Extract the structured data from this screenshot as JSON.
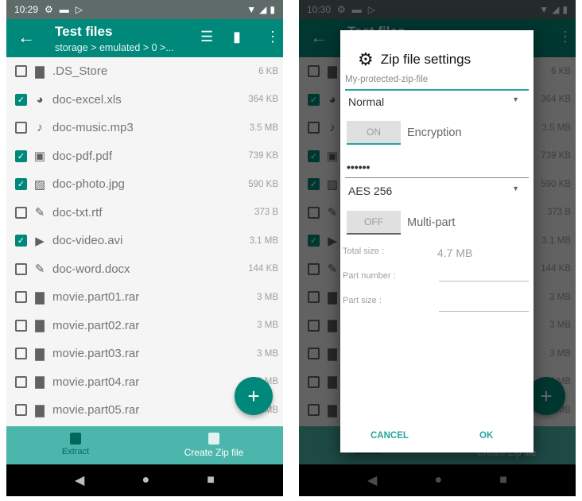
{
  "colors": {
    "primary": "#00897b",
    "bottom_nav": "#4db6ac",
    "status_bar": "#5e6b69"
  },
  "screens": [
    {
      "time": "10:29"
    },
    {
      "time": "10:30"
    }
  ],
  "toolbar": {
    "title": "Test files",
    "subtitle": "storage > emulated > 0 >..."
  },
  "files": [
    {
      "name": ".DS_Store",
      "size": "6 KB",
      "checked": false,
      "icon": "file-icon"
    },
    {
      "name": "doc-excel.xls",
      "size": "364 KB",
      "checked": true,
      "icon": "pie-chart-icon"
    },
    {
      "name": "doc-music.mp3",
      "size": "3.5 MB",
      "checked": false,
      "icon": "music-note-icon"
    },
    {
      "name": "doc-pdf.pdf",
      "size": "739 KB",
      "checked": true,
      "icon": "pdf-icon"
    },
    {
      "name": "doc-photo.jpg",
      "size": "590 KB",
      "checked": true,
      "icon": "image-icon"
    },
    {
      "name": "doc-txt.rtf",
      "size": "373 B",
      "checked": false,
      "icon": "pencil-icon"
    },
    {
      "name": "doc-video.avi",
      "size": "3.1 MB",
      "checked": true,
      "icon": "play-icon"
    },
    {
      "name": "doc-word.docx",
      "size": "144 KB",
      "checked": false,
      "icon": "pencil-icon"
    },
    {
      "name": "movie.part01.rar",
      "size": "3 MB",
      "checked": false,
      "icon": "file-icon"
    },
    {
      "name": "movie.part02.rar",
      "size": "3 MB",
      "checked": false,
      "icon": "file-icon"
    },
    {
      "name": "movie.part03.rar",
      "size": "3 MB",
      "checked": false,
      "icon": "file-icon"
    },
    {
      "name": "movie.part04.rar",
      "size": "3 MB",
      "checked": false,
      "icon": "file-icon"
    },
    {
      "name": "movie.part05.rar",
      "size": "3 MB",
      "checked": false,
      "icon": "file-icon"
    }
  ],
  "bottom_nav": {
    "extract": "Extract",
    "create": "Create Zip file",
    "active": "create"
  },
  "dialog": {
    "title": "Zip file settings",
    "filename": "My-protected-zip-file",
    "compression": "Normal",
    "encryption_toggle": "ON",
    "encryption_label": "Encryption",
    "password": "••••••",
    "algorithm": "AES 256",
    "multipart_toggle": "OFF",
    "multipart_label": "Multi-part",
    "total_size_label": "Total size :",
    "total_size": "4.7 MB",
    "part_number_label": "Part number :",
    "part_size_label": "Part size :",
    "cancel": "CANCEL",
    "ok": "OK"
  }
}
